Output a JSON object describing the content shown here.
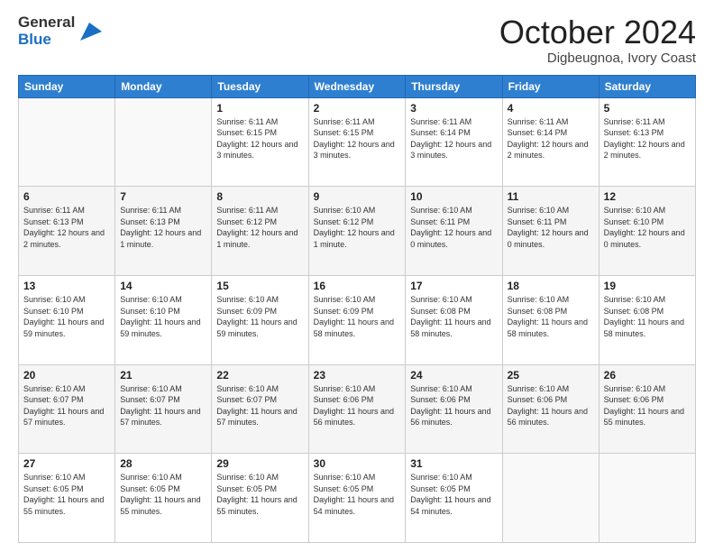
{
  "header": {
    "logo_line1": "General",
    "logo_line2": "Blue",
    "month": "October 2024",
    "location": "Digbeugnoa, Ivory Coast"
  },
  "weekdays": [
    "Sunday",
    "Monday",
    "Tuesday",
    "Wednesday",
    "Thursday",
    "Friday",
    "Saturday"
  ],
  "weeks": [
    [
      {
        "day": "",
        "info": ""
      },
      {
        "day": "",
        "info": ""
      },
      {
        "day": "1",
        "info": "Sunrise: 6:11 AM\nSunset: 6:15 PM\nDaylight: 12 hours and 3 minutes."
      },
      {
        "day": "2",
        "info": "Sunrise: 6:11 AM\nSunset: 6:15 PM\nDaylight: 12 hours and 3 minutes."
      },
      {
        "day": "3",
        "info": "Sunrise: 6:11 AM\nSunset: 6:14 PM\nDaylight: 12 hours and 3 minutes."
      },
      {
        "day": "4",
        "info": "Sunrise: 6:11 AM\nSunset: 6:14 PM\nDaylight: 12 hours and 2 minutes."
      },
      {
        "day": "5",
        "info": "Sunrise: 6:11 AM\nSunset: 6:13 PM\nDaylight: 12 hours and 2 minutes."
      }
    ],
    [
      {
        "day": "6",
        "info": "Sunrise: 6:11 AM\nSunset: 6:13 PM\nDaylight: 12 hours and 2 minutes."
      },
      {
        "day": "7",
        "info": "Sunrise: 6:11 AM\nSunset: 6:13 PM\nDaylight: 12 hours and 1 minute."
      },
      {
        "day": "8",
        "info": "Sunrise: 6:11 AM\nSunset: 6:12 PM\nDaylight: 12 hours and 1 minute."
      },
      {
        "day": "9",
        "info": "Sunrise: 6:10 AM\nSunset: 6:12 PM\nDaylight: 12 hours and 1 minute."
      },
      {
        "day": "10",
        "info": "Sunrise: 6:10 AM\nSunset: 6:11 PM\nDaylight: 12 hours and 0 minutes."
      },
      {
        "day": "11",
        "info": "Sunrise: 6:10 AM\nSunset: 6:11 PM\nDaylight: 12 hours and 0 minutes."
      },
      {
        "day": "12",
        "info": "Sunrise: 6:10 AM\nSunset: 6:10 PM\nDaylight: 12 hours and 0 minutes."
      }
    ],
    [
      {
        "day": "13",
        "info": "Sunrise: 6:10 AM\nSunset: 6:10 PM\nDaylight: 11 hours and 59 minutes."
      },
      {
        "day": "14",
        "info": "Sunrise: 6:10 AM\nSunset: 6:10 PM\nDaylight: 11 hours and 59 minutes."
      },
      {
        "day": "15",
        "info": "Sunrise: 6:10 AM\nSunset: 6:09 PM\nDaylight: 11 hours and 59 minutes."
      },
      {
        "day": "16",
        "info": "Sunrise: 6:10 AM\nSunset: 6:09 PM\nDaylight: 11 hours and 58 minutes."
      },
      {
        "day": "17",
        "info": "Sunrise: 6:10 AM\nSunset: 6:08 PM\nDaylight: 11 hours and 58 minutes."
      },
      {
        "day": "18",
        "info": "Sunrise: 6:10 AM\nSunset: 6:08 PM\nDaylight: 11 hours and 58 minutes."
      },
      {
        "day": "19",
        "info": "Sunrise: 6:10 AM\nSunset: 6:08 PM\nDaylight: 11 hours and 58 minutes."
      }
    ],
    [
      {
        "day": "20",
        "info": "Sunrise: 6:10 AM\nSunset: 6:07 PM\nDaylight: 11 hours and 57 minutes."
      },
      {
        "day": "21",
        "info": "Sunrise: 6:10 AM\nSunset: 6:07 PM\nDaylight: 11 hours and 57 minutes."
      },
      {
        "day": "22",
        "info": "Sunrise: 6:10 AM\nSunset: 6:07 PM\nDaylight: 11 hours and 57 minutes."
      },
      {
        "day": "23",
        "info": "Sunrise: 6:10 AM\nSunset: 6:06 PM\nDaylight: 11 hours and 56 minutes."
      },
      {
        "day": "24",
        "info": "Sunrise: 6:10 AM\nSunset: 6:06 PM\nDaylight: 11 hours and 56 minutes."
      },
      {
        "day": "25",
        "info": "Sunrise: 6:10 AM\nSunset: 6:06 PM\nDaylight: 11 hours and 56 minutes."
      },
      {
        "day": "26",
        "info": "Sunrise: 6:10 AM\nSunset: 6:06 PM\nDaylight: 11 hours and 55 minutes."
      }
    ],
    [
      {
        "day": "27",
        "info": "Sunrise: 6:10 AM\nSunset: 6:05 PM\nDaylight: 11 hours and 55 minutes."
      },
      {
        "day": "28",
        "info": "Sunrise: 6:10 AM\nSunset: 6:05 PM\nDaylight: 11 hours and 55 minutes."
      },
      {
        "day": "29",
        "info": "Sunrise: 6:10 AM\nSunset: 6:05 PM\nDaylight: 11 hours and 55 minutes."
      },
      {
        "day": "30",
        "info": "Sunrise: 6:10 AM\nSunset: 6:05 PM\nDaylight: 11 hours and 54 minutes."
      },
      {
        "day": "31",
        "info": "Sunrise: 6:10 AM\nSunset: 6:05 PM\nDaylight: 11 hours and 54 minutes."
      },
      {
        "day": "",
        "info": ""
      },
      {
        "day": "",
        "info": ""
      }
    ]
  ]
}
